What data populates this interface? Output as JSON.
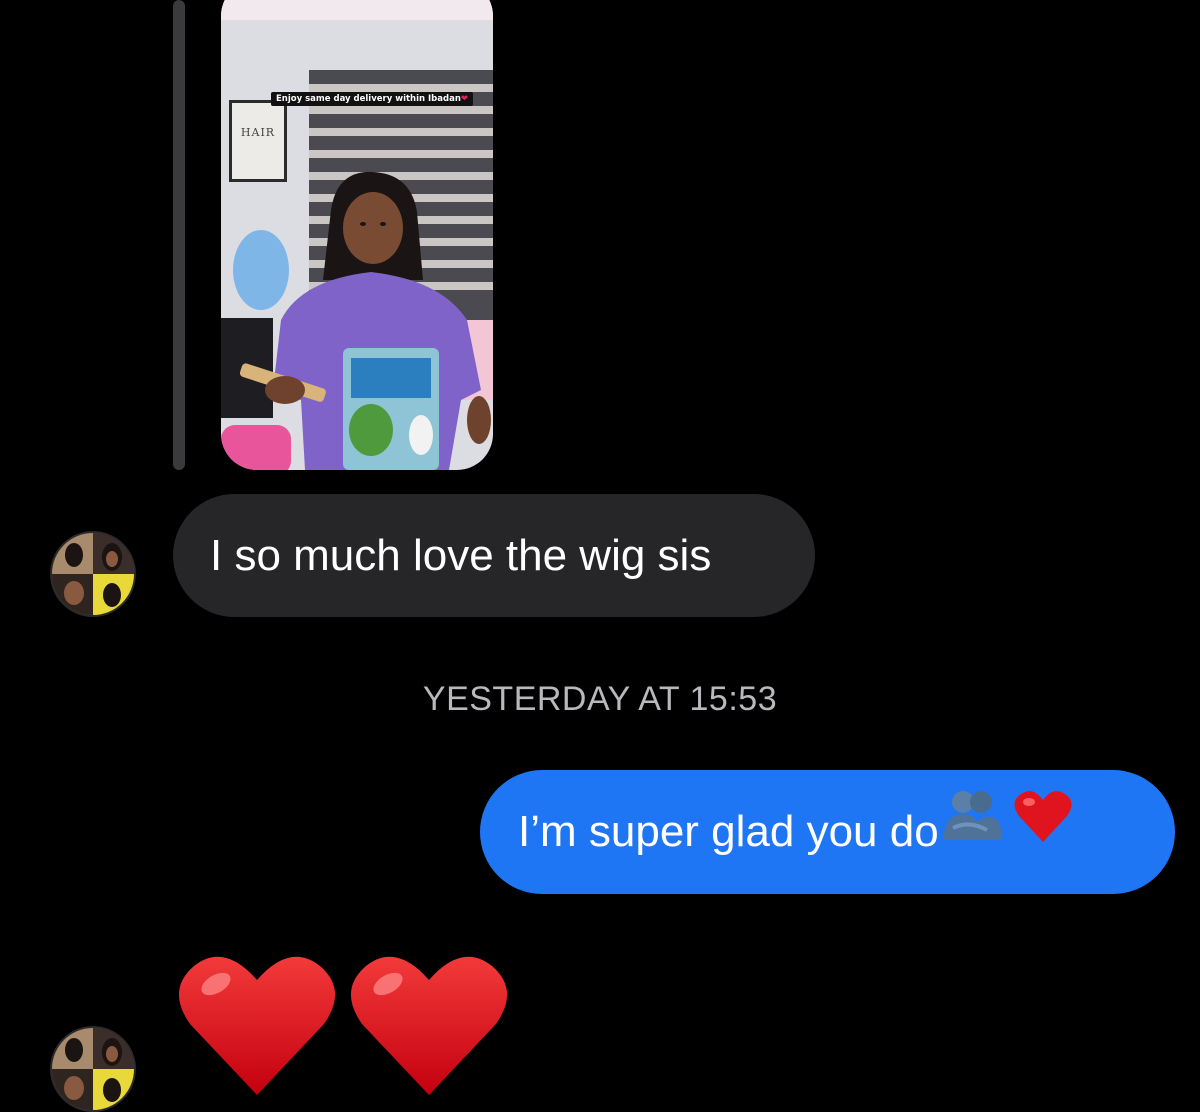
{
  "shared_post": {
    "caption": "Enjoy same day delivery within Ibadan",
    "caption_emoji": "❤",
    "frame_sign": "HAIR"
  },
  "messages": [
    {
      "direction": "incoming",
      "text": "I so much love the wig sis"
    },
    {
      "direction": "outgoing",
      "text": "I’m super glad you do",
      "emojis": [
        "people-hugging-icon",
        "red-heart-icon"
      ]
    },
    {
      "direction": "incoming",
      "emojis": [
        "red-heart-icon",
        "red-heart-icon"
      ]
    }
  ],
  "timestamp": "YESTERDAY AT 15:53",
  "colors": {
    "background": "#000000",
    "incoming_bubble": "#262628",
    "outgoing_bubble": "#1f76f5",
    "timestamp_text": "#b8b8bd",
    "heart": "#e0141e"
  }
}
